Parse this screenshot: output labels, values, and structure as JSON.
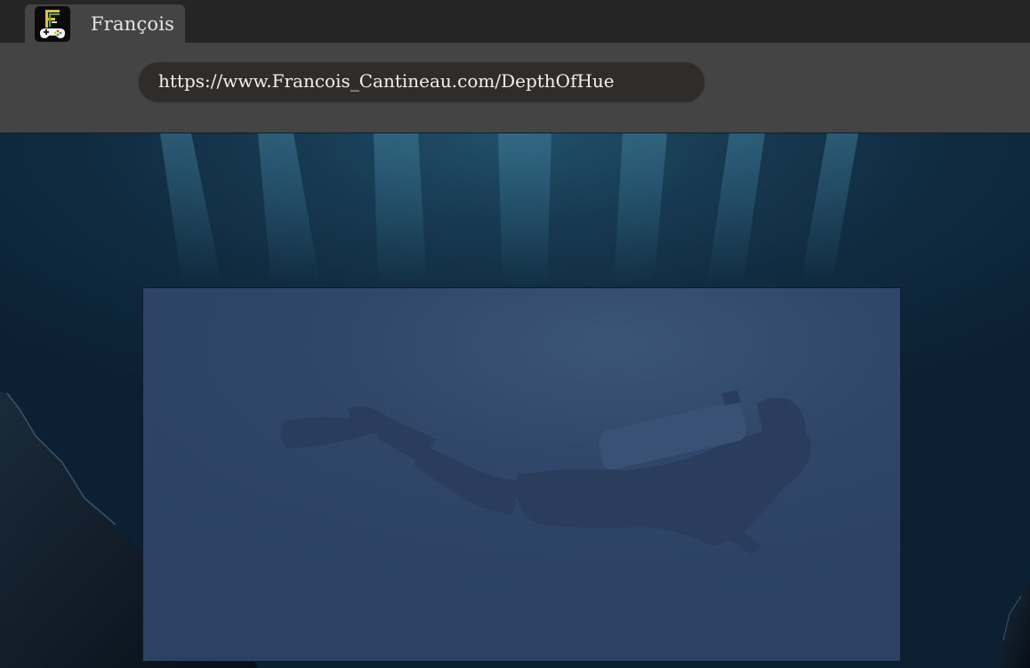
{
  "tab": {
    "title": "François",
    "icon": "game-controller-logo-icon"
  },
  "address_bar": {
    "url": "https://www.Francois_Cantineau.com/DepthOfHue"
  },
  "colors": {
    "tab_strip": "#252525",
    "toolbar": "#444444",
    "address_bar": "#2f2c2b",
    "ocean_deep": "#0b2032",
    "ocean_light": "#22506a",
    "panel": "#30476a"
  }
}
